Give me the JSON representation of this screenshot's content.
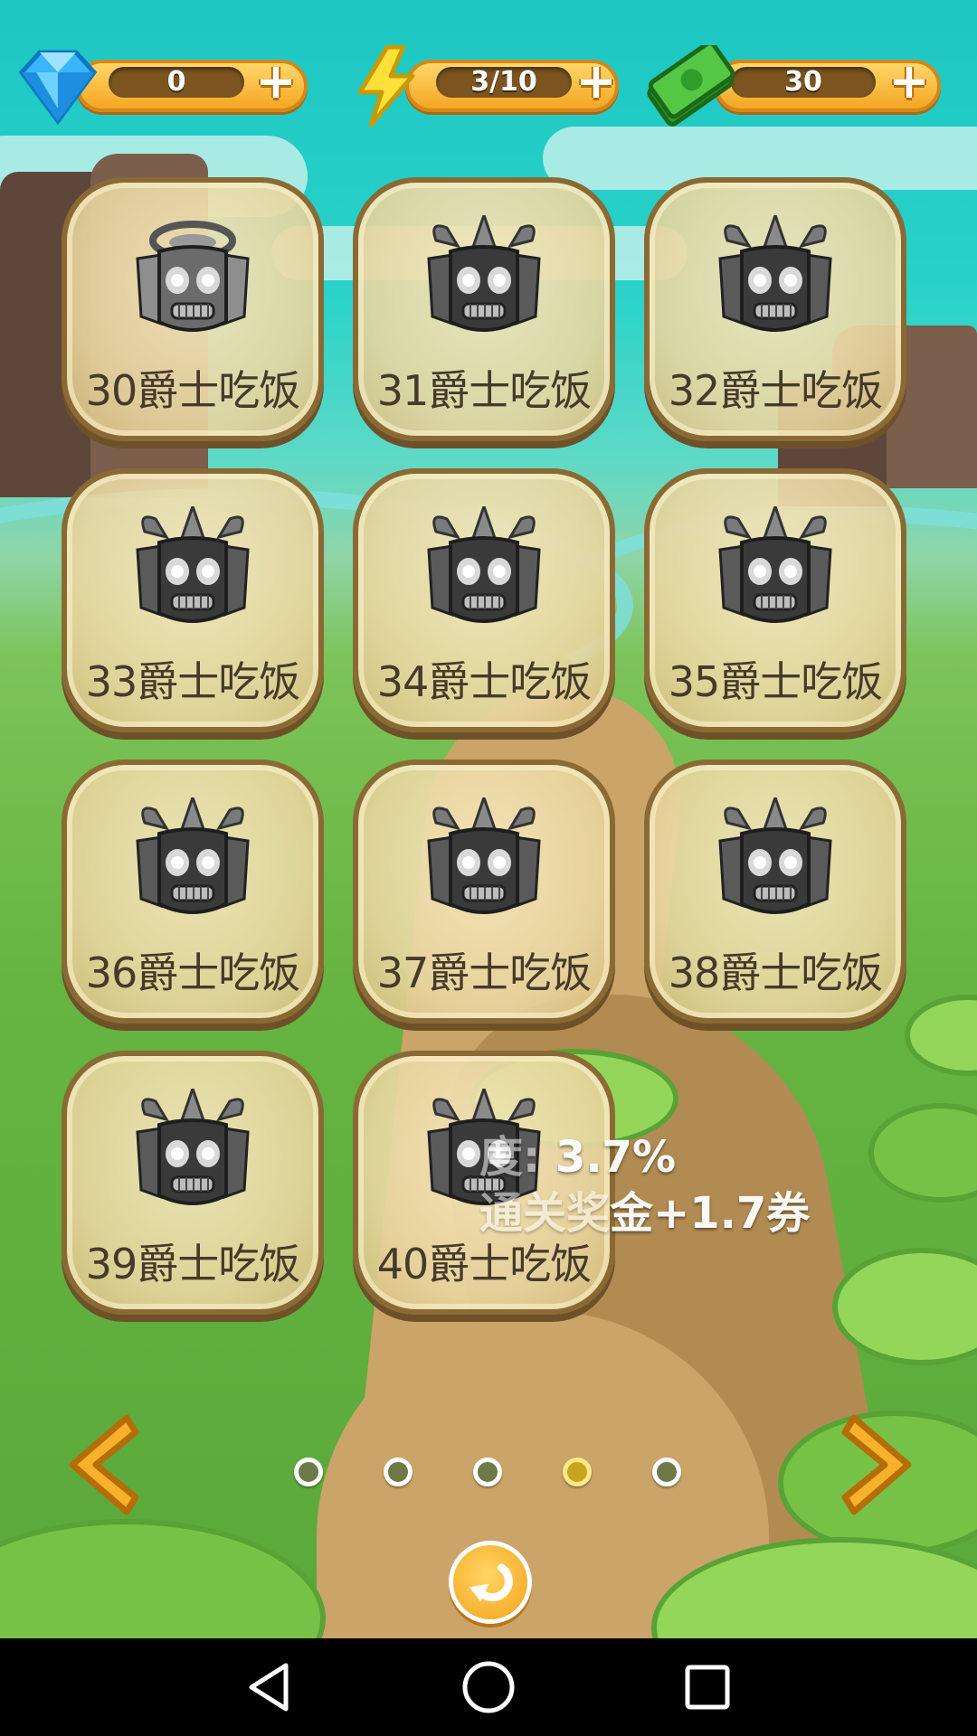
{
  "currency": {
    "gems": "0",
    "energy": "3/10",
    "cash": "30"
  },
  "levels": [
    {
      "label": "30爵士吃饭",
      "mask": "tiki-mask-icon",
      "variant": "light"
    },
    {
      "label": "31爵士吃饭",
      "mask": "tiki-mask-icon",
      "variant": "dark"
    },
    {
      "label": "32爵士吃饭",
      "mask": "tiki-mask-icon",
      "variant": "dark"
    },
    {
      "label": "33爵士吃饭",
      "mask": "tiki-mask-icon",
      "variant": "dark"
    },
    {
      "label": "34爵士吃饭",
      "mask": "tiki-mask-icon",
      "variant": "dark"
    },
    {
      "label": "35爵士吃饭",
      "mask": "tiki-mask-icon",
      "variant": "dark"
    },
    {
      "label": "36爵士吃饭",
      "mask": "tiki-mask-icon",
      "variant": "dark"
    },
    {
      "label": "37爵士吃饭",
      "mask": "tiki-mask-icon",
      "variant": "dark"
    },
    {
      "label": "38爵士吃饭",
      "mask": "tiki-mask-icon",
      "variant": "dark"
    },
    {
      "label": "39爵士吃饭",
      "mask": "tiki-mask-icon",
      "variant": "dark"
    },
    {
      "label": "40爵士吃饭",
      "mask": "tiki-mask-icon",
      "variant": "dark"
    }
  ],
  "progress": {
    "line1_label": "度:",
    "line1_value": "3.7%",
    "line2_label": "通关奖",
    "line2_value": "金+1.7券"
  },
  "pagination": {
    "page_count": 5,
    "active_page": 4
  },
  "colors": {
    "accent_orange": "#f5a623",
    "tile_border": "#8a6a34",
    "sky": "#1dc6c2",
    "grass": "#66b441"
  },
  "icons": {
    "gems": "diamond-icon",
    "energy": "lightning-icon",
    "cash": "cash-icon",
    "prev": "chevron-left-icon",
    "next": "chevron-right-icon",
    "back": "return-icon"
  }
}
